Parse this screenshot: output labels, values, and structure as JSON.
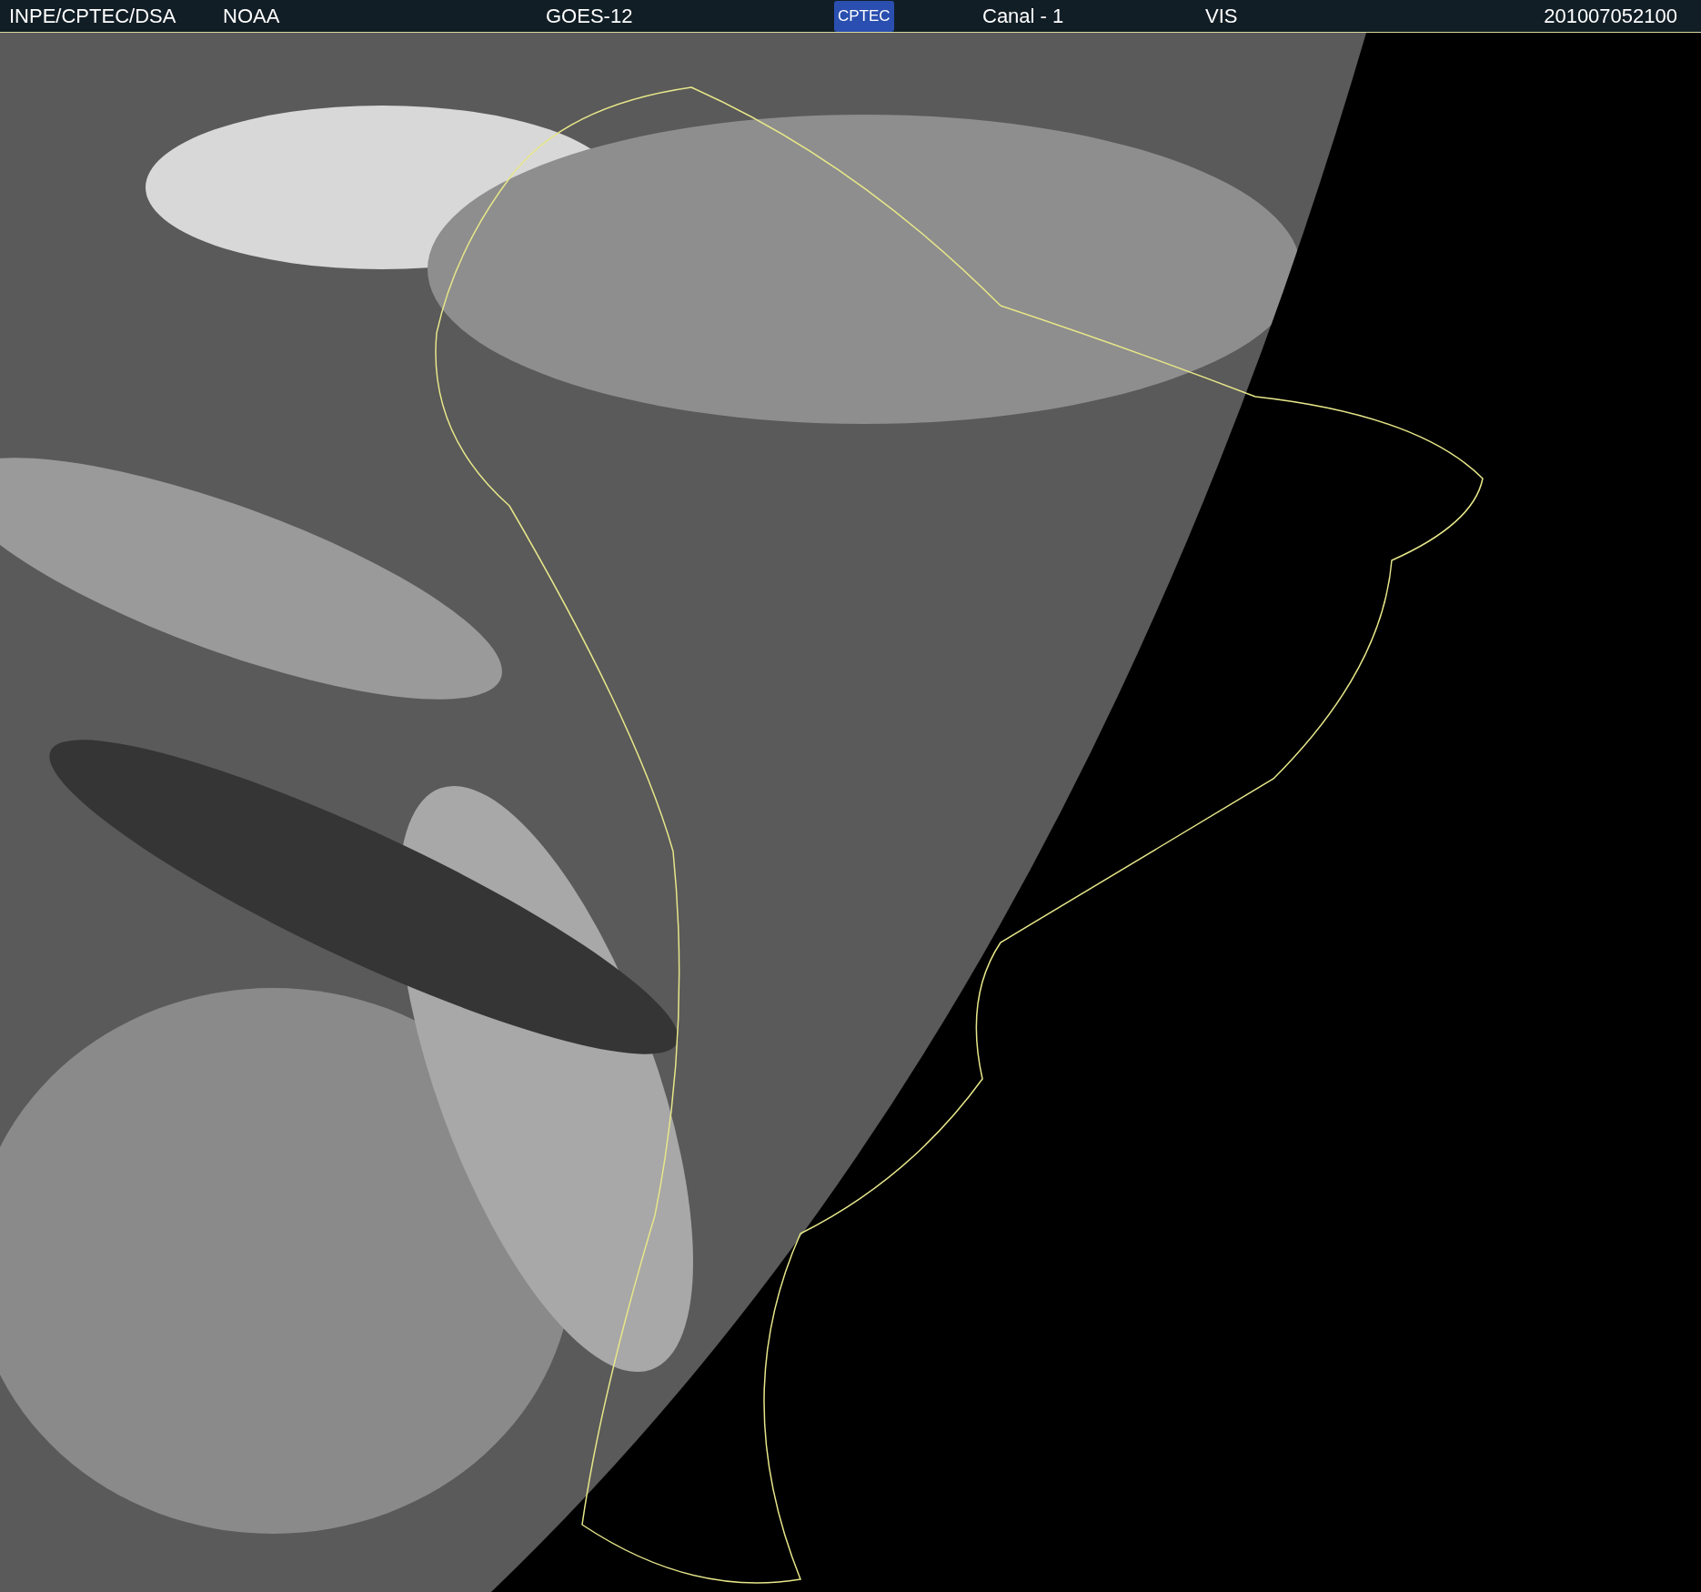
{
  "header": {
    "source": "INPE/CPTEC/DSA",
    "agency": "NOAA",
    "satellite": "GOES-12",
    "logo": "CPTEC",
    "channel": "Canal - 1",
    "band": "VIS",
    "timestamp": "201007052100"
  }
}
